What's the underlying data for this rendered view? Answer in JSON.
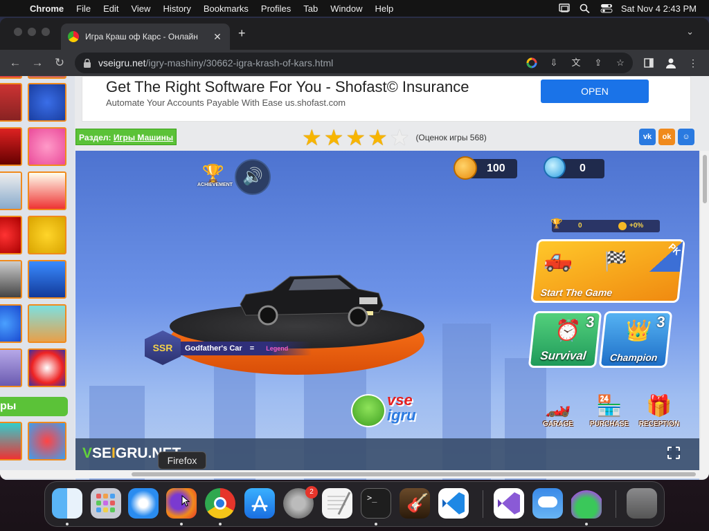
{
  "menubar": {
    "app": "Chrome",
    "items": [
      "File",
      "Edit",
      "View",
      "History",
      "Bookmarks",
      "Profiles",
      "Tab",
      "Window",
      "Help"
    ],
    "datetime": "Sat Nov 4  2:43 PM"
  },
  "browser": {
    "tab_title": "Игра Краш оф Карс - Онлайн",
    "url_host": "vseigru.net",
    "url_path": "/igry-mashiny/30662-igra-krash-of-kars.html"
  },
  "ad": {
    "title": "Get The Right Software For You - Shofast© Insurance",
    "subtitle": "Automate Your Accounts Payable With Ease us.shofast.com",
    "button": "OPEN"
  },
  "section": {
    "prefix": "Раздел:",
    "link": "Игры Машины"
  },
  "rating": {
    "stars": 4,
    "max": 5,
    "votes_text": "(Оценок игры 568)"
  },
  "social": [
    {
      "label": "vk",
      "color": "#2a7ae0"
    },
    {
      "label": "ok",
      "color": "#f08a1c"
    },
    {
      "label": "mm",
      "color": "#2a7ae0"
    }
  ],
  "sidebar": {
    "header": "ры"
  },
  "game": {
    "achievement": "ACHIEVEMENT",
    "coins": "100",
    "gems": "0",
    "stats": {
      "trophies": "0",
      "bonus": "+0%"
    },
    "start": "Start The Game",
    "pk": "PK",
    "modes": [
      {
        "label": "Survival",
        "count": "3"
      },
      {
        "label": "Champion",
        "count": "3"
      }
    ],
    "bottom": [
      "GARAGE",
      "PURCHASE",
      "RECEPTION"
    ],
    "car": {
      "rank": "SSR",
      "name": "Godfather's Car",
      "sep": "=",
      "rarity": "Legend"
    },
    "logo": {
      "top": "vse",
      "bottom": "igru"
    },
    "brand": {
      "v": "V",
      "rest": "SE",
      "i": "I",
      "tail": "GRU.NET"
    }
  },
  "dock": {
    "tooltip": "Firefox",
    "settings_badge": "2",
    "apps": [
      "Finder",
      "Launchpad",
      "Safari",
      "Firefox",
      "Chrome",
      "App Store",
      "System Settings",
      "TextEdit",
      "Terminal",
      "GarageBand",
      "VS Code",
      "Visual Studio",
      "Weather",
      "Automator",
      "Trash"
    ]
  }
}
